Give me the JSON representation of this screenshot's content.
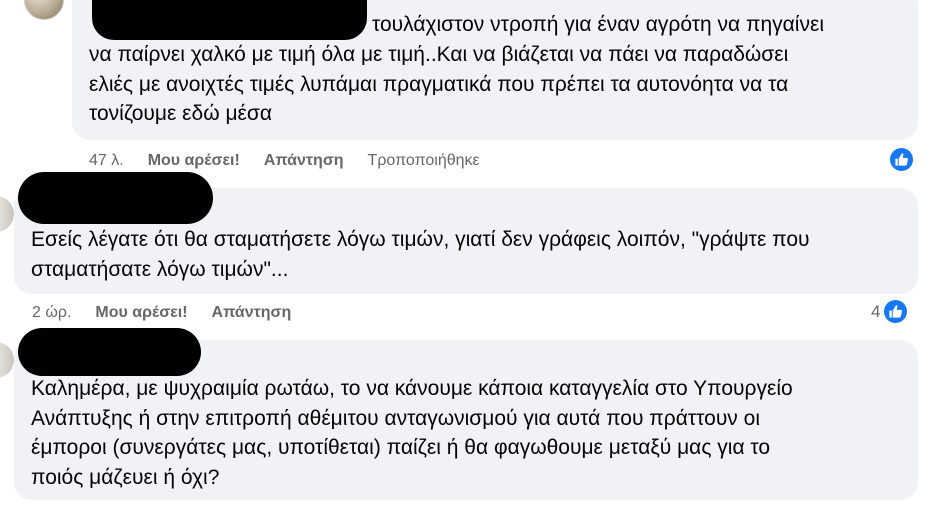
{
  "comments": [
    {
      "lines": [
        "τουλάχιστον ντροπή για έναν αγρότη να πηγαίνει",
        "να παίρνει χαλκό με τιμή όλα με τιμή..Και να βιάζεται να πάει να παραδώσει",
        "ελιές με ανοιχτές τιμές λυπάμαι πραγματικά που πρέπει τα αυτονόητα να τα",
        "τονίζουμε εδώ μέσα"
      ],
      "time": "47 λ.",
      "like_label": "Μου αρέσει!",
      "reply_label": "Απάντηση",
      "edited_label": "Τροποποιήθηκε",
      "reaction_count": ""
    },
    {
      "lines": [
        "Εσείς λέγατε ότι θα σταματήσετε λόγω τιμών, γιατί δεν γράφεις λοιπόν, \"γράψτε που",
        "σταματήσατε λόγω τιμών\"..."
      ],
      "time": "2 ώρ.",
      "like_label": "Μου αρέσει!",
      "reply_label": "Απάντηση",
      "reaction_count": "4"
    },
    {
      "lines": [
        "Καλημέρα, με ψυχραιμία ρωτάω, το να κάνουμε κάποια καταγγελία στο Υπουργείο",
        "Ανάπτυξης ή στην επιτροπή αθέμιτου ανταγωνισμού για αυτά που πράττουν οι",
        "έμποροι (συνεργάτες μας, υποτίθεται) παίζει ή θα φαγωθουμε μεταξύ μας για το",
        "ποιός μάζευει ή όχι?"
      ]
    }
  ],
  "icons": {
    "reaction": "thumbs-up-icon",
    "reaction_color": "#1877f2",
    "bubble_color": "#f0f2f5"
  }
}
